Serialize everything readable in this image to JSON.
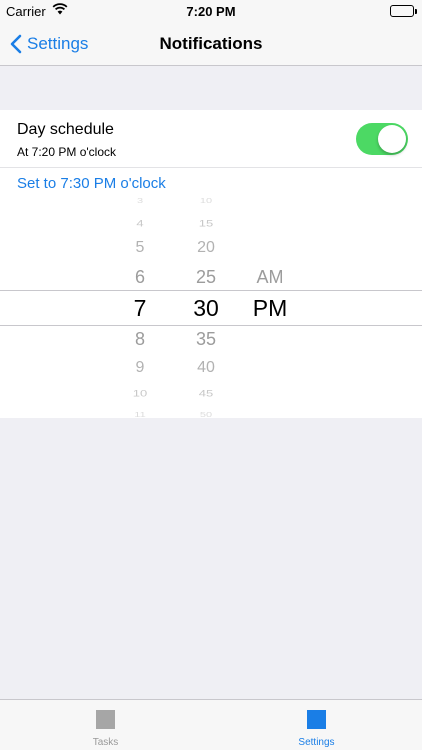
{
  "status_bar": {
    "carrier": "Carrier",
    "time": "7:20 PM"
  },
  "nav": {
    "back_label": "Settings",
    "title": "Notifications"
  },
  "schedule": {
    "title": "Day schedule",
    "subtitle": "At 7:20 PM o'clock",
    "toggle_on": true,
    "set_link": "Set to 7:30 PM o'clock"
  },
  "picker": {
    "hours": [
      "3",
      "4",
      "5",
      "6",
      "7",
      "8",
      "9",
      "10",
      "11"
    ],
    "minutes": [
      "10",
      "15",
      "20",
      "25",
      "30",
      "35",
      "40",
      "45",
      "50"
    ],
    "periods": [
      "AM",
      "PM"
    ],
    "selected": {
      "hour": "7",
      "minute": "30",
      "period": "PM"
    }
  },
  "tabs": [
    {
      "label": "Tasks",
      "active": false
    },
    {
      "label": "Settings",
      "active": true
    }
  ],
  "colors": {
    "accent": "#1a7ee6",
    "toggle": "#4cd964",
    "inactive": "#999999"
  }
}
